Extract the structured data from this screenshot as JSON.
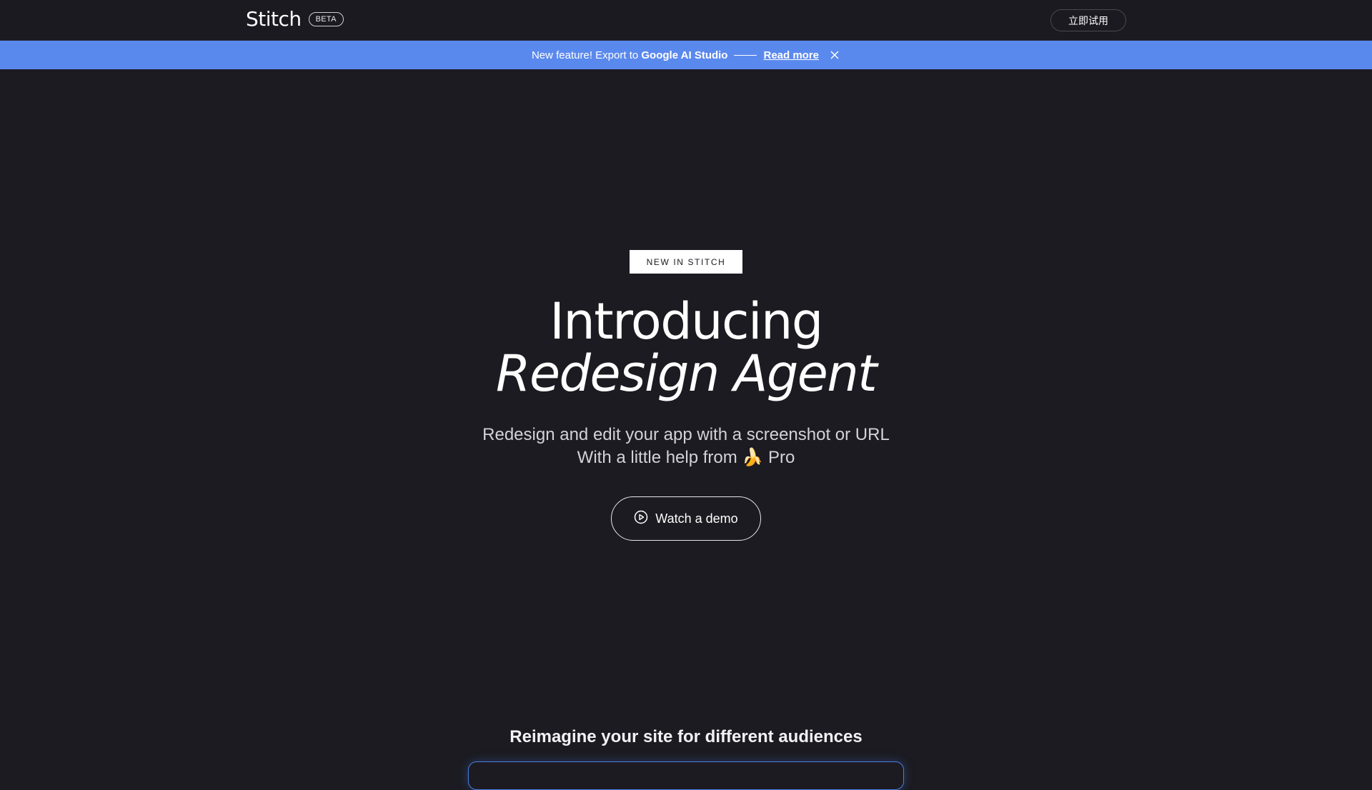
{
  "header": {
    "brand": "Stitch",
    "badge": "BETA",
    "cta": "立即试用"
  },
  "banner": {
    "prefix": "New feature! Export to ",
    "highlight": "Google AI Studio",
    "link": "Read more",
    "close_icon": "close-icon"
  },
  "hero": {
    "tag": "NEW IN STITCH",
    "title_line1": "Introducing",
    "title_line2": "Redesign Agent",
    "subtitle_line1": "Redesign and edit your app with a screenshot or URL",
    "subtitle_line2": "With a little help from 🍌 Pro",
    "demo_button": "Watch a demo",
    "demo_icon": "play-circle-icon"
  },
  "section": {
    "title": "Reimagine your site for different audiences"
  },
  "colors": {
    "background": "#1b1b21",
    "banner": "#5a89ee",
    "accent_border": "#4c7de3"
  }
}
